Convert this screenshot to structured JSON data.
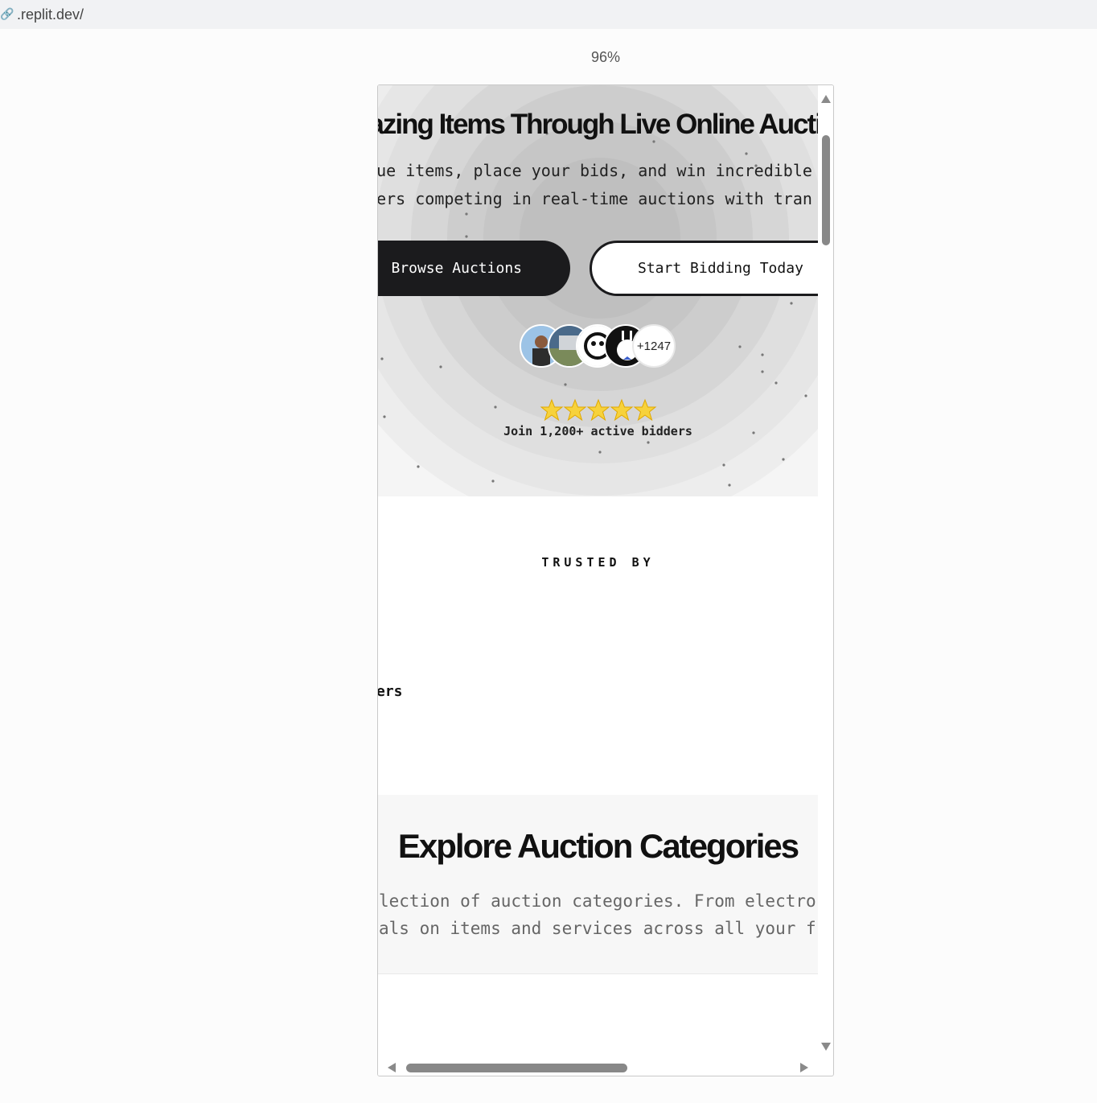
{
  "browser": {
    "url": ".replit.dev/",
    "url_icon": "link-icon",
    "zoom": "96%"
  },
  "hero": {
    "title": "Amazing Items Through Live Online Auctions",
    "subtitle_line1": "ique items, place your bids, and win incredible",
    "subtitle_line2": "dders competing in real-time auctions with tran",
    "browse_button": "Browse Auctions",
    "start_button": "Start Bidding Today",
    "avatar_count": "+1247",
    "rating_stars": 5,
    "join_text": "Join 1,200+ active bidders"
  },
  "trusted": {
    "heading": "TRUSTED BY",
    "partial_text": "ers"
  },
  "categories": {
    "title": "Explore Auction Categories",
    "subtitle_line1": "lection of auction categories. From electro",
    "subtitle_line2": "als on items and services across all your f"
  },
  "colors": {
    "dark_button": "#1b1b1d",
    "star": "#f5c518",
    "page_bg": "#fcfcfc"
  }
}
